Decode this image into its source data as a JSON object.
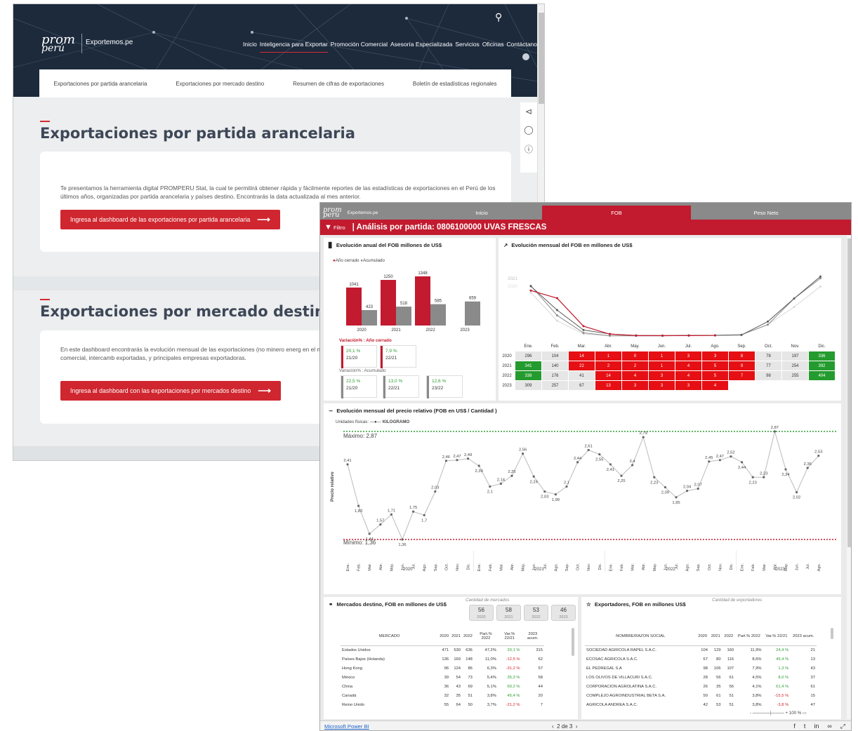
{
  "site": {
    "logo_top": "prom",
    "logo_bottom": "perú",
    "site_name": "Exportemos.pe",
    "nav": [
      "Inicio",
      "Inteligencia para Exportar",
      "Promoción Comercial",
      "Asesoría Especializada",
      "Servicios",
      "Oficinas",
      "Contáctanos"
    ],
    "nav_active": 1,
    "search_icon": "search-icon",
    "subtabs": [
      "Exportaciones por partida arancelaria",
      "Exportaciones por mercado destino",
      "Resumen de cifras de exportaciones",
      "Boletín de estadísticas regionales"
    ],
    "share_icons": [
      "share-icon",
      "whatsapp-icon",
      "help-icon"
    ],
    "section1": {
      "title": "Exportaciones por partida arancelaria",
      "text": "Te presentamos la herramienta digital PROMPERU Stat, la cual te permitirá obtener rápida y fácilmente reportes de las estadísticas de exportaciones en el Perú de los últimos años, organizadas por partida arancelaria y países destino. Encontrarás la data actualizada al mes anterior.",
      "button": "Ingresa al dashboard de las exportaciones por partida arancelaria"
    },
    "section2": {
      "title": "Exportaciones por mercado destino",
      "text": "En este dashboard encontrarás la evolución mensual de las exportaciones (no minero energ en el mundo. Incluye la siguiente data: monto FOB exportado, balanza comercial, intercamb exportadas, y principales empresas exportadoras.",
      "button": "Ingresa al dashboard con las exportaciones por mercados destino"
    },
    "arrow": "⟶",
    "brand_color": "#d0262f"
  },
  "pbi": {
    "logo_top": "prom",
    "logo_bottom": "perú",
    "site_name": "Exportemos.pe",
    "tabs": [
      "Inicio",
      "FOB",
      "Peso Neto"
    ],
    "filter_label": "Filtro",
    "title": "| Análisis por partida:  0806100000 UVAS FRESCAS",
    "annual": {
      "title": "Evolución anual del FOB millones de US$",
      "legend_closed": "Año cerrado",
      "legend_acc": "Acumulado",
      "var_closed_title": "Variación% : Año cerrado",
      "var_acc_title": "Variación% : Acumulado",
      "var_closed": [
        {
          "pct": "20,1 %",
          "period": "21/20",
          "color": "green"
        },
        {
          "pct": "7,9 %",
          "period": "22/21",
          "color": "green"
        }
      ],
      "var_acc": [
        {
          "pct": "22,5 %",
          "period": "21/20"
        },
        {
          "pct": "13,0 %",
          "period": "22/21"
        },
        {
          "pct": "12,6 %",
          "period": "23/22"
        }
      ]
    },
    "monthly": {
      "title": "Evolución mensual del FOB en millones de US$",
      "year_labels": [
        "2021",
        "2020"
      ],
      "months": [
        "Ene.",
        "Feb.",
        "Mar.",
        "Abr.",
        "May.",
        "Jun.",
        "Jul.",
        "Ago.",
        "Sep.",
        "Oct.",
        "Nov.",
        "Dic."
      ],
      "rows": [
        {
          "year": "2020",
          "values": [
            "296",
            "104",
            "14",
            "1",
            "0",
            "1",
            "3",
            "3",
            "8",
            "78",
            "197",
            "336"
          ]
        },
        {
          "year": "2021",
          "values": [
            "341",
            "140",
            "22",
            "2",
            "2",
            "1",
            "4",
            "5",
            "9",
            "77",
            "254",
            "392"
          ]
        },
        {
          "year": "2022",
          "values": [
            "338",
            "176",
            "41",
            "14",
            "4",
            "3",
            "4",
            "5",
            "7",
            "98",
            "255",
            "404"
          ]
        },
        {
          "year": "2023",
          "values": [
            "309",
            "257",
            "67",
            "13",
            "3",
            "3",
            "3",
            "4",
            "",
            "",
            "",
            ""
          ]
        }
      ]
    },
    "price": {
      "title": "Evolución mensual del precio relativo (FOB en US$ / Cantidad )",
      "units_label": "Unidades físicas:",
      "units_value": "KILOGRAMO",
      "max_label": "Máximo: 2,87",
      "min_label": "Mínimo: 1,36",
      "ylabel": "Precio relativo",
      "years": [
        "2020",
        "2021",
        "2022",
        "2023"
      ],
      "month_abbr": [
        "Ene.",
        "Feb.",
        "Mar.",
        "Abr.",
        "May.",
        "Jun.",
        "Jul.",
        "Ago.",
        "Sep.",
        "Oct.",
        "Nov.",
        "Dic."
      ]
    },
    "markets": {
      "title": "Mercados destino, FOB en millones de US$",
      "count_title": "Cantidad de mercados",
      "counts": [
        {
          "n": "56",
          "y": "2020"
        },
        {
          "n": "58",
          "y": "2021"
        },
        {
          "n": "53",
          "y": "2022"
        },
        {
          "n": "46",
          "y": "2023"
        }
      ],
      "headers": [
        "MERCADO",
        "2020",
        "2021",
        "2022",
        "Part.% 2022",
        "Var.% 22/21",
        "2023 acum."
      ],
      "rows": [
        [
          "Estados Unidos",
          "471",
          "530",
          "636",
          "47,2%",
          "20,1 %",
          "315"
        ],
        [
          "Países Bajos (Holanda)",
          "136",
          "169",
          "148",
          "11,0%",
          "-12,5 %",
          "62"
        ],
        [
          "Hong Kong",
          "96",
          "124",
          "86",
          "6,3%",
          "-31,2 %",
          "57"
        ],
        [
          "México",
          "39",
          "54",
          "73",
          "5,4%",
          "35,3 %",
          "58"
        ],
        [
          "China",
          "36",
          "43",
          "69",
          "5,1%",
          "60,2 %",
          "44"
        ],
        [
          "Canadá",
          "32",
          "35",
          "51",
          "3,8%",
          "45,4 %",
          "20"
        ],
        [
          "Reino Unido",
          "55",
          "64",
          "50",
          "3,7%",
          "-21,2 %",
          "7"
        ]
      ]
    },
    "exporters": {
      "title": "Exportadores, FOB en millones US$",
      "count_title": "Cantidad de exportadores",
      "headers": [
        "NOMBRE/RAZON SOCIAL",
        "2020",
        "2021",
        "2022",
        "Part.% 2022",
        "Var.% 22/21",
        "2023 acum."
      ],
      "rows": [
        [
          "SOCIEDAD AGRICOLA RAPEL S.A.C.",
          "104",
          "129",
          "160",
          "11,9%",
          "24,4 %",
          "21"
        ],
        [
          "ECOSAC AGRICOLA S.A.C.",
          "67",
          "80",
          "116",
          "8,6%",
          "45,4 %",
          "13"
        ],
        [
          "EL PEDREGAL S.A",
          "98",
          "106",
          "107",
          "7,9%",
          "1,3 %",
          "43"
        ],
        [
          "LOS OLIVOS DE VILLACURI S.A.C.",
          "28",
          "56",
          "61",
          "4,5%",
          "8,0 %",
          "37"
        ],
        [
          "CORPORACION AGROLATINA S.A.C.",
          "26",
          "35",
          "56",
          "4,1%",
          "61,4 %",
          "61"
        ],
        [
          "COMPLEJO AGROINDUSTRIAL BETA S.A.",
          "50",
          "61",
          "51",
          "3,8%",
          "-15,5 %",
          "15"
        ],
        [
          "AGRICOLA ANDREA S.A.C.",
          "42",
          "53",
          "51",
          "3,8%",
          "-3,8 %",
          "47"
        ]
      ]
    },
    "zoom": "100 %",
    "footer_link": "Microsoft Power BI",
    "pager": "2 de 3",
    "social_icons": [
      "facebook-icon",
      "twitter-icon",
      "linkedin-icon",
      "link-icon",
      "fullscreen-icon"
    ],
    "colors": {
      "red": "#c21a2e",
      "grey": "#8a8a8a",
      "green": "#2e9e32"
    }
  },
  "chart_data": [
    {
      "type": "bar",
      "title": "Evolución anual del FOB millones de US$",
      "categories": [
        "2020",
        "2021",
        "2022",
        "2023"
      ],
      "series": [
        {
          "name": "Año cerrado",
          "values": [
            1041,
            1250,
            1348,
            null
          ]
        },
        {
          "name": "Acumulado",
          "values": [
            423,
            518,
            585,
            659
          ]
        }
      ]
    },
    {
      "type": "line",
      "title": "Evolución mensual del FOB en millones de US$",
      "x": [
        "Ene.",
        "Feb.",
        "Mar.",
        "Abr.",
        "May.",
        "Jun.",
        "Jul.",
        "Ago.",
        "Sep.",
        "Oct.",
        "Nov.",
        "Dic."
      ],
      "series": [
        {
          "name": "2020",
          "values": [
            296,
            104,
            14,
            1,
            0,
            1,
            3,
            3,
            8,
            78,
            197,
            336
          ]
        },
        {
          "name": "2021",
          "values": [
            341,
            140,
            22,
            2,
            2,
            1,
            4,
            5,
            9,
            77,
            254,
            392
          ]
        },
        {
          "name": "2022",
          "values": [
            338,
            176,
            41,
            14,
            4,
            3,
            4,
            5,
            7,
            98,
            255,
            404
          ]
        },
        {
          "name": "2023",
          "values": [
            309,
            257,
            67,
            13,
            3,
            3,
            3,
            4,
            null,
            null,
            null,
            null
          ]
        }
      ]
    },
    {
      "type": "line",
      "title": "Evolución mensual del precio relativo (FOB en US$ / Cantidad )",
      "ylabel": "Precio relativo",
      "max": 2.87,
      "min": 1.36,
      "series": [
        {
          "name": "KILOGRAMO",
          "values": [
            2.41,
            1.83,
            1.44,
            1.57,
            1.71,
            1.36,
            1.75,
            1.7,
            2.03,
            2.46,
            2.47,
            2.49,
            2.39,
            2.1,
            2.14,
            2.25,
            2.56,
            2.24,
            2.03,
            1.99,
            2.1,
            2.44,
            2.61,
            2.55,
            2.41,
            2.25,
            2.4,
            2.79,
            2.23,
            2.09,
            1.95,
            2.04,
            2.07,
            2.45,
            2.47,
            2.52,
            2.44,
            2.23,
            2.23,
            2.87,
            2.34,
            2.02,
            2.36,
            2.53
          ]
        }
      ]
    }
  ]
}
